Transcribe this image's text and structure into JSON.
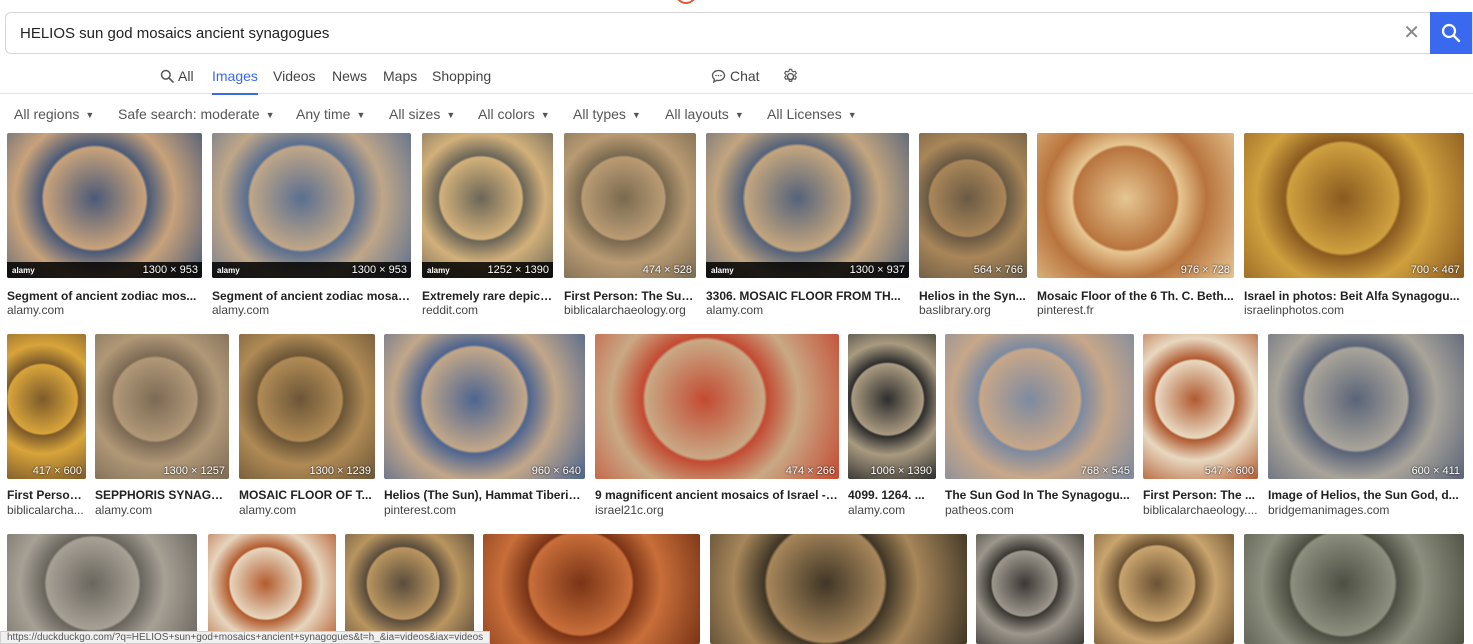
{
  "search": {
    "query": "HELIOS sun god mosaics ancient synagogues"
  },
  "nav": {
    "all": "All",
    "images": "Images",
    "videos": "Videos",
    "news": "News",
    "maps": "Maps",
    "shopping": "Shopping",
    "chat": "Chat"
  },
  "filters": [
    "All regions",
    "Safe search: moderate",
    "Any time",
    "All sizes",
    "All colors",
    "All types",
    "All layouts",
    "All Licenses"
  ],
  "colors": {
    "accent": "#3969ef",
    "brand": "#de5833"
  },
  "results_row1": [
    {
      "dims": "1300 × 953",
      "title": "Segment of ancient zodiac mos...",
      "domain": "alamy.com",
      "watermark": "alamy",
      "c1": "#c8a27a",
      "c2": "#4a5a78"
    },
    {
      "dims": "1300 × 953",
      "title": "Segment of ancient zodiac mosai...",
      "domain": "alamy.com",
      "watermark": "alamy",
      "c1": "#bfa688",
      "c2": "#5a6f90"
    },
    {
      "dims": "1252 × 1390",
      "title": "Extremely rare depict...",
      "domain": "reddit.com",
      "watermark": "alamy",
      "c1": "#d2b07a",
      "c2": "#6b6658"
    },
    {
      "dims": "474 × 528",
      "title": "First Person: The Sun...",
      "domain": "biblicalarchaeology.org",
      "watermark": "",
      "c1": "#b99b73",
      "c2": "#7a6a50"
    },
    {
      "dims": "1300 × 937",
      "title": "3306. MOSAIC FLOOR FROM TH...",
      "domain": "alamy.com",
      "watermark": "alamy",
      "c1": "#c3a57e",
      "c2": "#55637a"
    },
    {
      "dims": "564 × 766",
      "title": "Helios in the Syn...",
      "domain": "baslibrary.org",
      "watermark": "",
      "c1": "#a98658",
      "c2": "#6a5a44"
    },
    {
      "dims": "976 × 728",
      "title": "Mosaic Floor of the 6 Th. C. Beth...",
      "domain": "pinterest.fr",
      "watermark": "",
      "c1": "#b9743e",
      "c2": "#e6c691"
    },
    {
      "dims": "700 × 467",
      "title": "Israel in photos: Beit Alfa Synagogu...",
      "domain": "israelinphotos.com",
      "watermark": "",
      "c1": "#cfa03e",
      "c2": "#8a5a20"
    }
  ],
  "results_row2": [
    {
      "dims": "417 × 600",
      "title": "First Person...",
      "domain": "biblicalarcha...",
      "c1": "#d8a43a",
      "c2": "#7c5a2a"
    },
    {
      "dims": "1300 × 1257",
      "title": "SEPPHORIS SYNAGO...",
      "domain": "alamy.com",
      "c1": "#b09877",
      "c2": "#7d6a55"
    },
    {
      "dims": "1300 × 1239",
      "title": "MOSAIC FLOOR OF T...",
      "domain": "alamy.com",
      "c1": "#b08a55",
      "c2": "#6c5637"
    },
    {
      "dims": "960 × 640",
      "title": "Helios (The Sun), Hammat Tiberia...",
      "domain": "pinterest.com",
      "c1": "#c2a789",
      "c2": "#4e6590"
    },
    {
      "dims": "474 × 266",
      "title": "9 magnificent ancient mosaics of Israel - ...",
      "domain": "israel21c.org",
      "c1": "#c9a985",
      "c2": "#c34a32"
    },
    {
      "dims": "1006 × 1390",
      "title": "4099. 1264. ...",
      "domain": "alamy.com",
      "c1": "#a99a80",
      "c2": "#2e2e2e"
    },
    {
      "dims": "768 × 545",
      "title": "The Sun God In The Synagogu...",
      "domain": "patheos.com",
      "c1": "#c7a789",
      "c2": "#7d8aa0"
    },
    {
      "dims": "547 × 600",
      "title": "First Person: The ...",
      "domain": "biblicalarchaeology....",
      "c1": "#e8d8c0",
      "c2": "#b05a30"
    },
    {
      "dims": "600 × 411",
      "title": "Image of Helios, the Sun God, d...",
      "domain": "bridgemanimages.com",
      "c1": "#a9a49a",
      "c2": "#5a6478"
    }
  ],
  "results_row3": [
    {
      "c1": "#a7a095",
      "c2": "#6a665e"
    },
    {
      "c1": "#e6d5bd",
      "c2": "#b35c2f"
    },
    {
      "c1": "#b9955f",
      "c2": "#5a4c3c"
    },
    {
      "c1": "#c86e3a",
      "c2": "#7a3416"
    },
    {
      "c1": "#a7865a",
      "c2": "#3f3626"
    },
    {
      "c1": "#9c968c",
      "c2": "#3b3834"
    },
    {
      "c1": "#c9a46e",
      "c2": "#6b5233"
    },
    {
      "c1": "#8c8f7e",
      "c2": "#4d4f43"
    }
  ],
  "status": {
    "url": "https://duckduckgo.com/?q=HELIOS+sun+god+mosaics+ancient+synagogues&t=h_&ia=videos&iax=videos"
  }
}
